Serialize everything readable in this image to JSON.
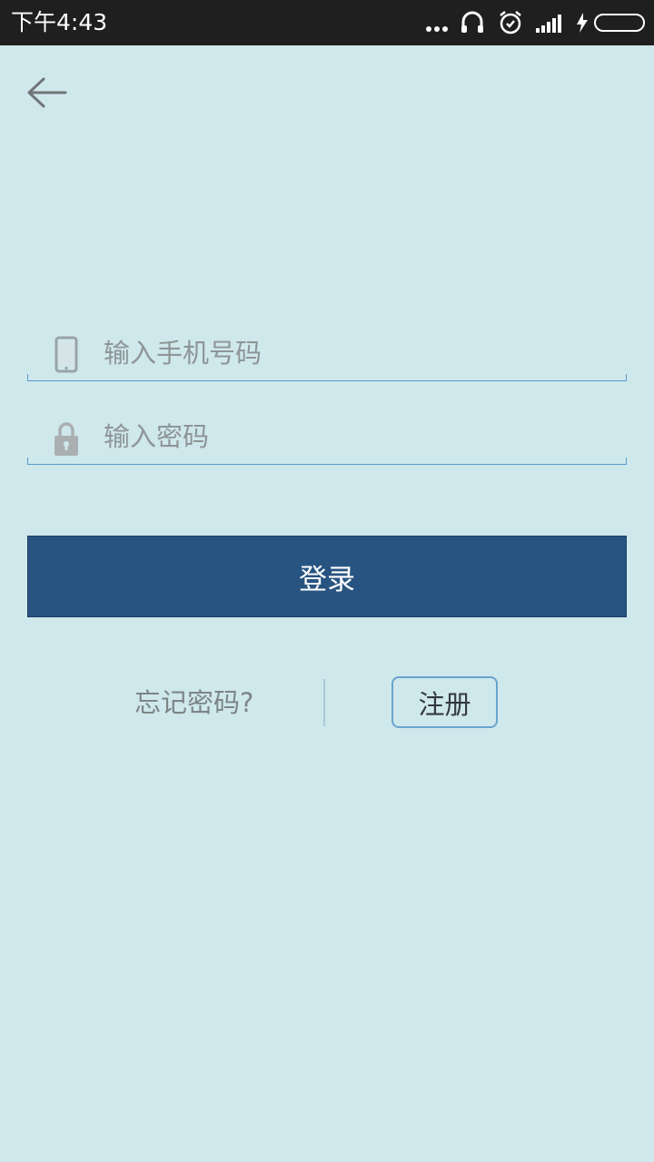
{
  "status_bar": {
    "time": "下午4:43",
    "icons": [
      "more-dots-icon",
      "headset-icon",
      "alarm-icon",
      "signal-icon",
      "charging-icon",
      "battery-icon"
    ]
  },
  "nav": {
    "back_icon": "arrow-left-icon"
  },
  "form": {
    "phone": {
      "icon": "phone-icon",
      "placeholder": "输入手机号码",
      "value": ""
    },
    "password": {
      "icon": "lock-icon",
      "placeholder": "输入密码",
      "value": ""
    },
    "login_label": "登录"
  },
  "links": {
    "forgot_password": "忘记密码?",
    "register": "注册"
  },
  "colors": {
    "background": "#cfe8ec",
    "status_bar": "#1f1f1f",
    "primary": "#285482",
    "accent_border": "#6aa3cc",
    "underline": "#5b9bc9"
  }
}
